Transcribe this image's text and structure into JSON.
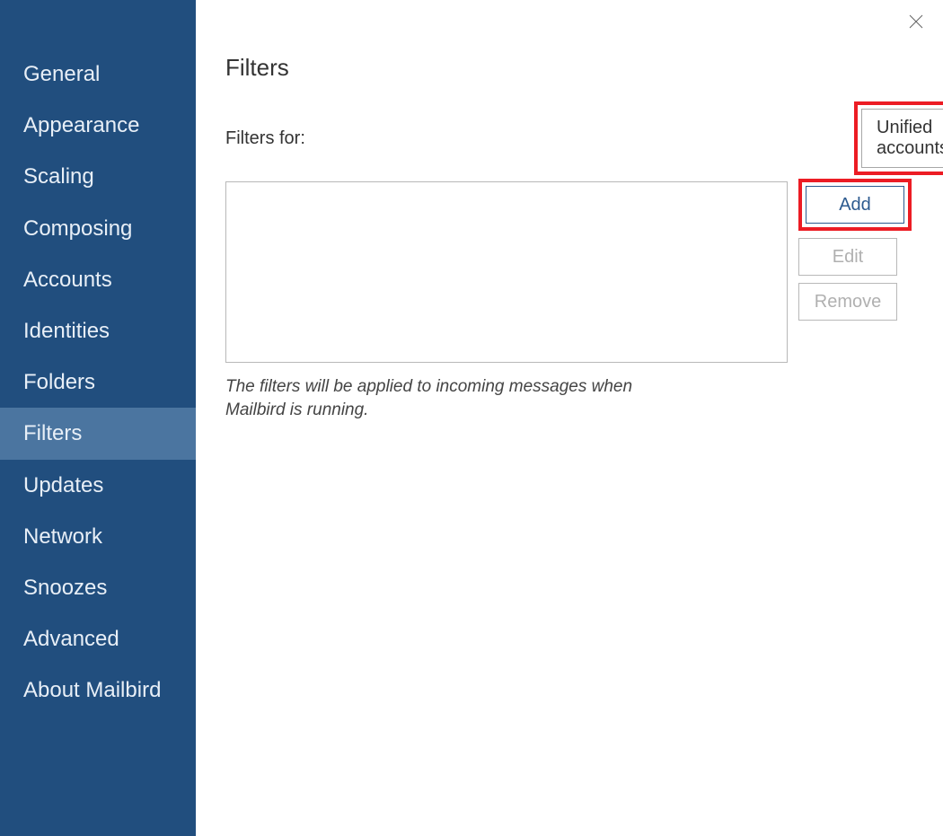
{
  "sidebar": {
    "items": [
      {
        "label": "General",
        "selected": false
      },
      {
        "label": "Appearance",
        "selected": false
      },
      {
        "label": "Scaling",
        "selected": false
      },
      {
        "label": "Composing",
        "selected": false
      },
      {
        "label": "Accounts",
        "selected": false
      },
      {
        "label": "Identities",
        "selected": false
      },
      {
        "label": "Folders",
        "selected": false
      },
      {
        "label": "Filters",
        "selected": true
      },
      {
        "label": "Updates",
        "selected": false
      },
      {
        "label": "Network",
        "selected": false
      },
      {
        "label": "Snoozes",
        "selected": false
      },
      {
        "label": "Advanced",
        "selected": false
      },
      {
        "label": "About Mailbird",
        "selected": false
      }
    ]
  },
  "main": {
    "title": "Filters",
    "filters_for_label": "Filters for:",
    "account_dropdown": {
      "selected": "Unified accounts"
    },
    "buttons": {
      "add": "Add",
      "edit": "Edit",
      "remove": "Remove"
    },
    "hint": "The filters will be applied to incoming messages when Mailbird is running."
  },
  "highlight_color": "#ec1c24"
}
